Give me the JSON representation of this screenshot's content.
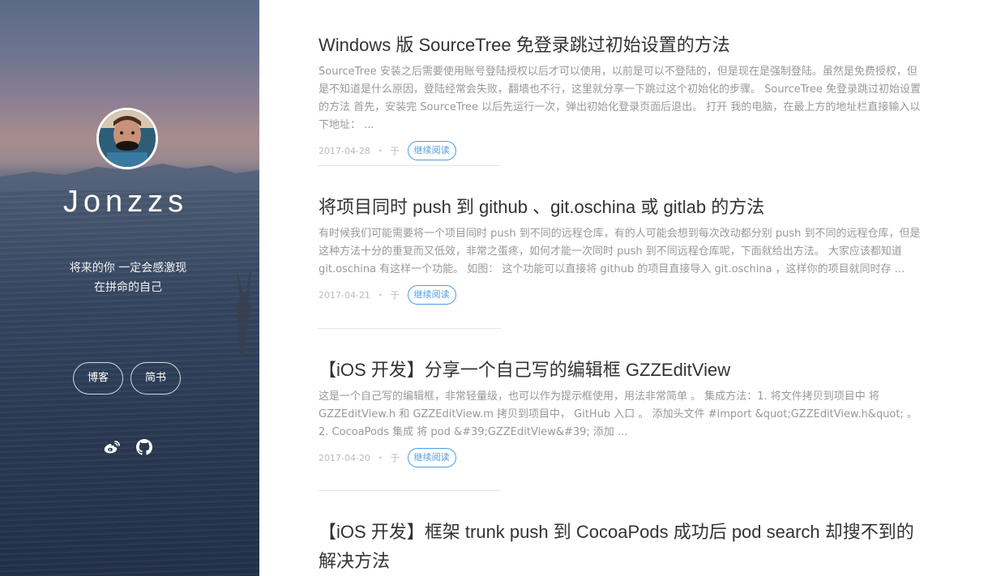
{
  "sidebar": {
    "site_name": "Jonzzs",
    "motto_line1": "将来的你 一定会感激现",
    "motto_line2": "在拼命的自己",
    "nav": [
      {
        "label": "博客"
      },
      {
        "label": "简书"
      }
    ],
    "social_icons": [
      "weibo-icon",
      "github-icon"
    ]
  },
  "posts": [
    {
      "title": "Windows 版 SourceTree 免登录跳过初始设置的方法",
      "excerpt": "SourceTree 安装之后需要使用账号登陆授权以后才可以使用，以前是可以不登陆的，但是现在是强制登陆。虽然是免费授权，但是不知道是什么原因，登陆经常会失败，翻墙也不行，这里就分享一下跳过这个初始化的步骤。 SourceTree 免登录跳过初始设置的方法 首先，安装完 SourceTree 以后先运行一次，弹出初始化登录页面后退出。 打开 我的电脑，在最上方的地址栏直接输入以下地址： ...",
      "date": "2017-04-28",
      "dot": "•",
      "yu": "于",
      "read_more": "继续阅读"
    },
    {
      "title": "将项目同时 push 到 github 、git.oschina 或 gitlab 的方法",
      "excerpt": "有时候我们可能需要将一个项目同时 push 到不同的远程仓库，有的人可能会想到每次改动都分别 push 到不同的远程仓库，但是这种方法十分的重复而又低效，非常之蛋疼，如何才能一次同时 push 到不同远程仓库呢，下面就给出方法。 大家应该都知道 git.oschina 有这样一个功能。 如图： 这个功能可以直接将 github 的项目直接导入 git.oschina ，这样你的项目就同时存 ...",
      "date": "2017-04-21",
      "dot": "•",
      "yu": "于",
      "read_more": "继续阅读"
    },
    {
      "title": "【iOS 开发】分享一个自己写的编辑框 GZZEditView",
      "excerpt": "这是一个自己写的编辑框，非常轻量级，也可以作为提示框使用，用法非常简单 。 集成方法：1. 将文件拷贝到项目中 将 GZZEditView.h 和 GZZEditView.m 拷贝到项目中， GitHub 入口 。 添加头文件 #import &quot;GZZEditView.h&quot; 。 2. CocoaPods 集成 将 pod &#39;GZZEditView&#39; 添加 ...",
      "date": "2017-04-20",
      "dot": "•",
      "yu": "于",
      "read_more": "继续阅读"
    },
    {
      "title": "【iOS 开发】框架 trunk push 到 CocoaPods 成功后 pod search 却搜不到的解决方法"
    }
  ],
  "colors": {
    "title": "#333333",
    "excerpt": "#999999",
    "meta": "#bbbbbb",
    "accent": "#4d9cdd"
  }
}
